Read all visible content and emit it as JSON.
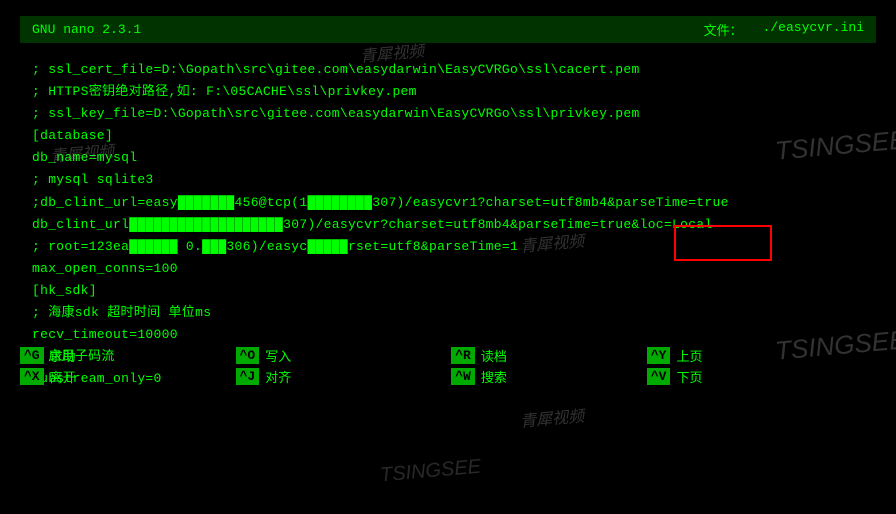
{
  "header": {
    "app_name": "GNU nano 2.3.1",
    "file_label": "文件：",
    "file_path": "./easycvr.ini"
  },
  "lines": [
    "; ssl_cert_file=D:\\Gopath\\src\\gitee.com\\easydarwin\\EasyCVRGo\\ssl\\cacert.pem",
    "; HTTPS密钥绝对路径,如: F:\\05CACHE\\ssl\\privkey.pem",
    "; ssl_key_file=D:\\Gopath\\src\\gitee.com\\easydarwin\\EasyCVRGo\\ssl\\privkey.pem",
    "[database]",
    "db_name=mysql",
    "; mysql sqlite3",
    ";db_clint_url=easy███████456@tcp(1████████307)/easycvr1?charset=utf8mb4&parseTime=true",
    "db_clint_url███████████████████307)/easycvr?charset=utf8mb4&parseTime=true&loc=Local",
    "; root=123ea██████ 0.███306)/easyc█████rset=utf8&parseTime=1",
    "max_open_conns=100",
    "",
    "[hk_sdk]",
    "; 海康sdk 超时时间 单位ms",
    "recv_timeout=10000",
    "; 启用子码流",
    "substream_only=0"
  ],
  "footer": {
    "col1": [
      {
        "key": "^G",
        "label": "求助"
      },
      {
        "key": "^X",
        "label": "离开"
      }
    ],
    "col2": [
      {
        "key": "^O",
        "label": "写入"
      },
      {
        "key": "^J",
        "label": "对齐"
      }
    ],
    "col3": [
      {
        "key": "^R",
        "label": "读档"
      },
      {
        "key": "^W",
        "label": "搜索"
      }
    ],
    "col4": [
      {
        "key": "^Y",
        "label": "上页"
      },
      {
        "key": "^V",
        "label": "下页"
      }
    ]
  },
  "watermarks": {
    "logo": "TSINGSEE",
    "cn1": "青犀视频",
    "cn2": "青犀视频"
  }
}
